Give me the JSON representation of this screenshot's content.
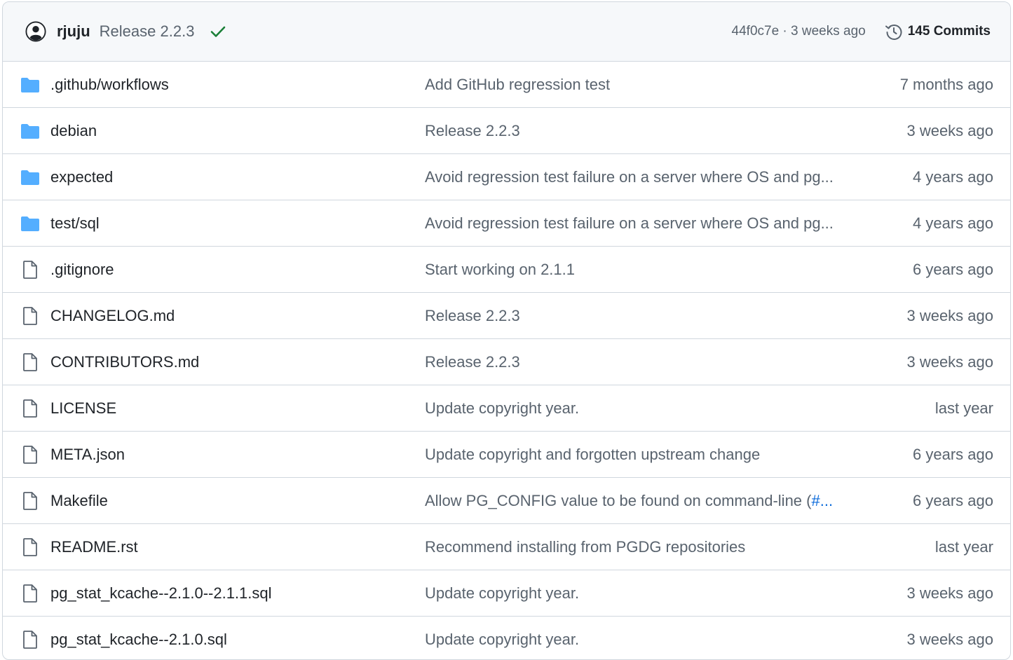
{
  "header": {
    "author": "rjuju",
    "commit_message": "Release 2.2.3",
    "sha_time": "44f0c7e · 3 weeks ago",
    "commits_label": "145 Commits"
  },
  "colors": {
    "folder": "#54aeff",
    "check": "#1a7f37",
    "link": "#0969da"
  },
  "files": [
    {
      "type": "folder",
      "name": ".github/workflows",
      "message": "Add GitHub regression test",
      "age": "7 months ago"
    },
    {
      "type": "folder",
      "name": "debian",
      "message": "Release 2.2.3",
      "age": "3 weeks ago"
    },
    {
      "type": "folder",
      "name": "expected",
      "message": "Avoid regression test failure on a server where OS and pg...",
      "age": "4 years ago"
    },
    {
      "type": "folder",
      "name": "test/sql",
      "message": "Avoid regression test failure on a server where OS and pg...",
      "age": "4 years ago"
    },
    {
      "type": "file",
      "name": ".gitignore",
      "message": "Start working on 2.1.1",
      "age": "6 years ago"
    },
    {
      "type": "file",
      "name": "CHANGELOG.md",
      "message": "Release 2.2.3",
      "age": "3 weeks ago"
    },
    {
      "type": "file",
      "name": "CONTRIBUTORS.md",
      "message": "Release 2.2.3",
      "age": "3 weeks ago"
    },
    {
      "type": "file",
      "name": "LICENSE",
      "message": "Update copyright year.",
      "age": "last year"
    },
    {
      "type": "file",
      "name": "META.json",
      "message": "Update copyright and forgotten upstream change",
      "age": "6 years ago"
    },
    {
      "type": "file",
      "name": "Makefile",
      "message": "Allow PG_CONFIG value to be found on command-line (",
      "message_link": "#...",
      "age": "6 years ago"
    },
    {
      "type": "file",
      "name": "README.rst",
      "message": "Recommend installing from PGDG repositories",
      "age": "last year"
    },
    {
      "type": "file",
      "name": "pg_stat_kcache--2.1.0--2.1.1.sql",
      "message": "Update copyright year.",
      "age": "3 weeks ago"
    },
    {
      "type": "file",
      "name": "pg_stat_kcache--2.1.0.sql",
      "message": "Update copyright year.",
      "age": "3 weeks ago"
    }
  ]
}
